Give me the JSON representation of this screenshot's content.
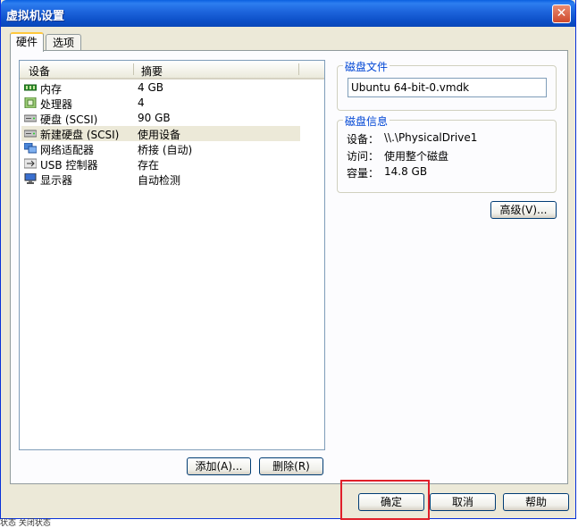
{
  "window": {
    "title": "虚拟机设置",
    "close_glyph": "✕"
  },
  "tabs": [
    {
      "label": "硬件",
      "active": true
    },
    {
      "label": "选项",
      "active": false
    }
  ],
  "device_list": {
    "columns": [
      "设备",
      "摘要"
    ],
    "rows": [
      {
        "name": "内存",
        "summary": "4 GB",
        "icon": "memory-icon",
        "selected": false
      },
      {
        "name": "处理器",
        "summary": "4",
        "icon": "processor-icon",
        "selected": false
      },
      {
        "name": "硬盘 (SCSI)",
        "summary": "90 GB",
        "icon": "hard-disk-icon",
        "selected": false
      },
      {
        "name": "新建硬盘 (SCSI)",
        "summary": "使用设备",
        "icon": "hard-disk-icon",
        "selected": true
      },
      {
        "name": "网络适配器",
        "summary": "桥接 (自动)",
        "icon": "network-adapter-icon",
        "selected": false
      },
      {
        "name": "USB 控制器",
        "summary": "存在",
        "icon": "usb-icon",
        "selected": false
      },
      {
        "name": "显示器",
        "summary": "自动检测",
        "icon": "monitor-icon",
        "selected": false
      }
    ]
  },
  "list_buttons": {
    "add": "添加(A)...",
    "remove": "删除(R)"
  },
  "disk_file": {
    "title": "磁盘文件",
    "value": "Ubuntu 64-bit-0.vmdk"
  },
  "disk_info": {
    "title": "磁盘信息",
    "device_label": "设备：",
    "device_value": "\\\\.\\PhysicalDrive1",
    "access_label": "访问：",
    "access_value": "使用整个磁盘",
    "capacity_label": "容量：",
    "capacity_value": "14.8 GB"
  },
  "advanced_button": "高级(V)...",
  "footer_buttons": {
    "ok": "确定",
    "cancel": "取消",
    "help": "帮助"
  },
  "status_text": "状态  关闭状态",
  "colors": {
    "title_bar": "#0a5fe0",
    "highlight_border": "#e0202a",
    "group_title": "#0046d5"
  }
}
